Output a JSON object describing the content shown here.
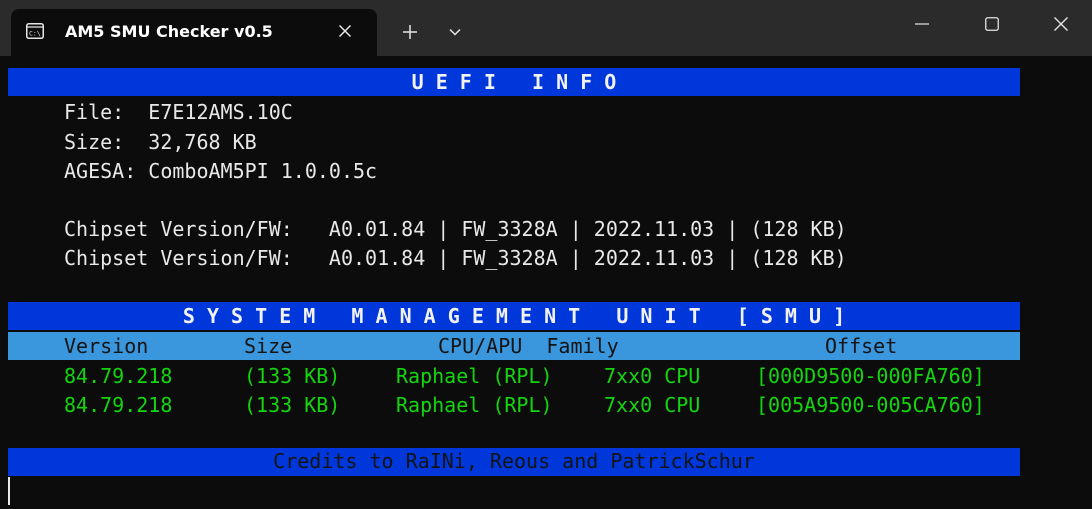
{
  "window": {
    "tab_title": "AM5 SMU Checker v0.5",
    "tab_icon": "terminal-icon",
    "new_tab_icon": "plus-icon",
    "dropdown_icon": "chevron-down-icon"
  },
  "uefi": {
    "heading": "U E F I   I N F O",
    "file_line": "File:  E7E12AMS.10C",
    "size_line": "Size:  32,768 KB",
    "agesa_line": "AGESA: ComboAM5PI 1.0.0.5c",
    "chipset_lines": [
      "Chipset Version/FW:   A0.01.84 | FW_3328A | 2022.11.03 | (128 KB)",
      "Chipset Version/FW:   A0.01.84 | FW_3328A | 2022.11.03 | (128 KB)"
    ]
  },
  "smu": {
    "heading": "S Y S T E M   M A N A G E M E N T   U N I T   [ S M U ]",
    "columns": {
      "version": "Version",
      "size": "Size",
      "cpu_family": "CPU/APU  Family",
      "offset": "Offset"
    },
    "rows": [
      {
        "version": "84.79.218",
        "size": "(133 KB)",
        "cpu": "Raphael (RPL)",
        "family": "7xx0 CPU",
        "offset": "[000D9500-000FA760]"
      },
      {
        "version": "84.79.218",
        "size": "(133 KB)",
        "cpu": "Raphael (RPL)",
        "family": "7xx0 CPU",
        "offset": "[005A9500-005CA760]"
      }
    ]
  },
  "credits": "Credits to RaINi, Reous and PatrickSchur",
  "colors": {
    "bar_blue": "#0037da",
    "header_blue": "#3a96dd",
    "green": "#13d60e",
    "text": "#e8e8e8"
  }
}
